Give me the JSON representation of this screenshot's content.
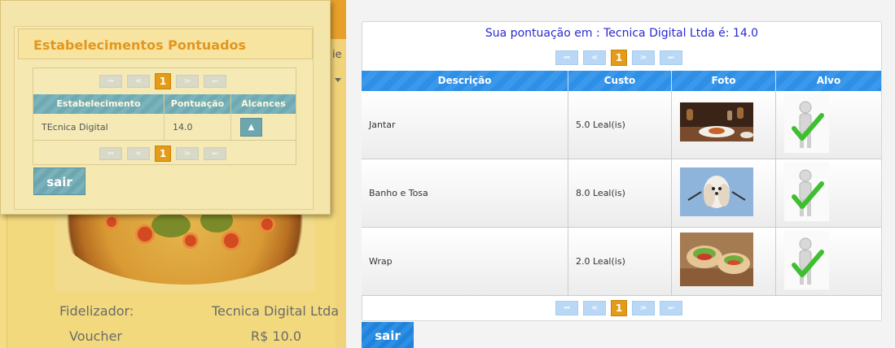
{
  "background": {
    "fidelizador_label": "Fidelizador:",
    "fidelizador_value": "Tecnica Digital Ltda",
    "voucher_label": "Voucher",
    "voucher_value": "R$ 10.0",
    "strip_text": "ie"
  },
  "left_dialog": {
    "title": "Estabelecimentos Pontuados",
    "pager": {
      "first": "⏮",
      "prev": "≪",
      "page": "1",
      "next": "≫",
      "last": "⏭"
    },
    "columns": [
      "Estabelecimento",
      "Pontuação",
      "Alcances"
    ],
    "rows": [
      {
        "estabelecimento": "TEcnica Digital",
        "pontuacao": "14.0"
      }
    ],
    "sair_label": "sair"
  },
  "right_dialog": {
    "title": "Sua pontuação em : Tecnica Digital Ltda é: 14.0",
    "pager": {
      "first": "⏮",
      "prev": "≪",
      "page": "1",
      "next": "≫",
      "last": "⏭"
    },
    "columns": [
      "Descrição",
      "Custo",
      "Foto",
      "Alvo"
    ],
    "rows": [
      {
        "descricao": "Jantar",
        "custo": "5.0 Leal(is)",
        "foto": "dinner-photo",
        "alvo": "target-figure-icon"
      },
      {
        "descricao": "Banho e Tosa",
        "custo": "8.0 Leal(is)",
        "foto": "dog-grooming-photo",
        "alvo": "target-figure-icon"
      },
      {
        "descricao": "Wrap",
        "custo": "2.0 Leal(is)",
        "foto": "wrap-photo",
        "alvo": "target-figure-icon"
      }
    ],
    "sair_label": "sair"
  },
  "colors": {
    "accent_orange": "#e39c17",
    "accent_blue": "#2e8fe6",
    "title_blue": "#2a2ad0",
    "check_green": "#3fbf2f"
  }
}
